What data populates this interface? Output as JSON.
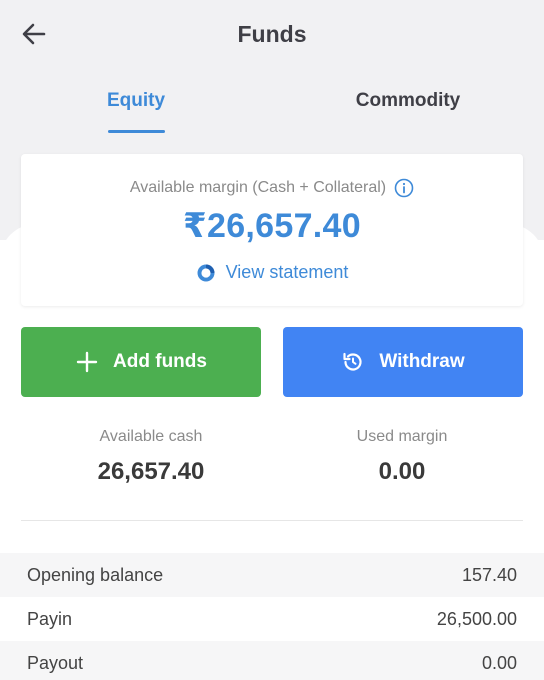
{
  "header": {
    "title": "Funds",
    "back_icon": "arrow-left-icon"
  },
  "tabs": [
    {
      "label": "Equity",
      "active": true
    },
    {
      "label": "Commodity",
      "active": false
    }
  ],
  "margin_card": {
    "label": "Available margin (Cash + Collateral)",
    "amount": "₹26,657.40",
    "view_statement": "View statement"
  },
  "actions": {
    "add_funds": "Add funds",
    "withdraw": "Withdraw"
  },
  "stats": {
    "available_cash_label": "Available cash",
    "available_cash_value": "26,657.40",
    "used_margin_label": "Used margin",
    "used_margin_value": "0.00"
  },
  "breakdown": [
    {
      "label": "Opening balance",
      "value": "157.40"
    },
    {
      "label": "Payin",
      "value": "26,500.00"
    },
    {
      "label": "Payout",
      "value": "0.00"
    }
  ],
  "colors": {
    "accent": "#3e8ad8",
    "add_button": "#4caf50",
    "withdraw_button": "#4184f3"
  }
}
